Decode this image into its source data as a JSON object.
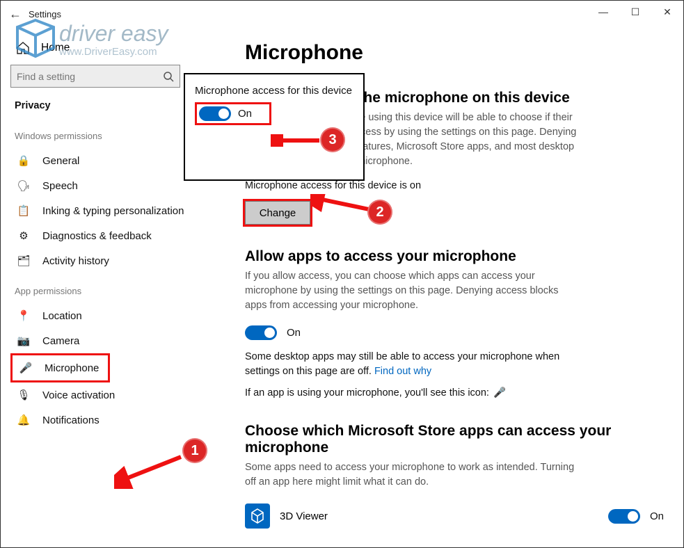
{
  "titlebar": {
    "back": "←",
    "title": "Settings",
    "min": "—",
    "max": "☐",
    "close": "✕"
  },
  "sidebar": {
    "home": "Home",
    "search_placeholder": "Find a setting",
    "privacy_head": "Privacy",
    "windows_header": "Windows permissions",
    "windows_items": [
      {
        "icon": "lock-icon",
        "glyph": "🔒",
        "label": "General"
      },
      {
        "icon": "speech-icon",
        "glyph": "🗣",
        "label": "Speech"
      },
      {
        "icon": "inking-icon",
        "glyph": "📋",
        "label": "Inking & typing personalization"
      },
      {
        "icon": "diagnostics-icon",
        "glyph": "⚙",
        "label": "Diagnostics & feedback"
      },
      {
        "icon": "history-icon",
        "glyph": "🗂",
        "label": "Activity history"
      }
    ],
    "apps_header": "App permissions",
    "apps_items": [
      {
        "icon": "location-icon",
        "glyph": "📍",
        "label": "Location"
      },
      {
        "icon": "camera-icon",
        "glyph": "📷",
        "label": "Camera"
      },
      {
        "icon": "microphone-icon",
        "glyph": "🎤",
        "label": "Microphone"
      },
      {
        "icon": "voice-icon",
        "glyph": "🎙",
        "label": "Voice activation"
      },
      {
        "icon": "notifications-icon",
        "glyph": "🔔",
        "label": "Notifications"
      }
    ]
  },
  "main": {
    "h1": "Microphone",
    "h2a": "Allow access to the microphone on this device",
    "p1": "If you allow access, people using this device will be able to choose if their apps have microphone access by using the settings on this page. Denying access blocks Windows features, Microsoft Store apps, and most desktop apps from accessing the microphone.",
    "status": "Microphone access for this device is on",
    "change": "Change",
    "h2b": "Allow apps to access your microphone",
    "p2": "If you allow access, you can choose which apps can access your microphone by using the settings on this page. Denying access blocks apps from accessing your microphone.",
    "toggle_label": "On",
    "p3a": "Some desktop apps may still be able to access your microphone when settings on this page are off. ",
    "p3b": "Find out why",
    "p4": "If an app is using your microphone, you'll see this icon:",
    "h2c": "Choose which Microsoft Store apps can access your microphone",
    "p5": "Some apps need to access your microphone to work as intended. Turning off an app here might limit what it can do.",
    "app1": "3D Viewer",
    "app1_toggle": "On"
  },
  "popup": {
    "title": "Microphone access for this device",
    "toggle_label": "On"
  },
  "callouts": {
    "c1": "1",
    "c2": "2",
    "c3": "3"
  },
  "watermark": {
    "line1": "driver easy",
    "line2": "www.DriverEasy.com"
  }
}
